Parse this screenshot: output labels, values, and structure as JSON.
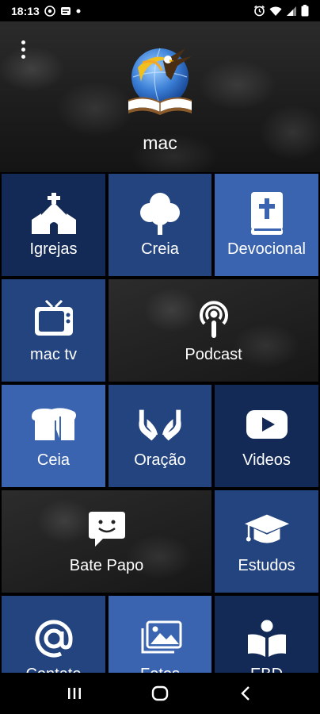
{
  "status_bar": {
    "time": "18:13",
    "left_icons": [
      "whatsapp-icon",
      "message-icon",
      "dot-icon"
    ],
    "right_icons": [
      "alarm-icon",
      "wifi-icon",
      "signal-icon",
      "battery-icon"
    ]
  },
  "header": {
    "app_name": "mac",
    "menu_icon": "more-vert-icon",
    "logo": "eagle-globe-bible-logo"
  },
  "tiles": [
    {
      "label": "Igrejas",
      "icon": "church-icon"
    },
    {
      "label": "Creia",
      "icon": "tree-icon"
    },
    {
      "label": "Devocional",
      "icon": "bible-icon"
    },
    {
      "label": "mac tv",
      "icon": "tv-icon"
    },
    {
      "label": "Podcast",
      "icon": "podcast-icon"
    },
    {
      "label": "Ceia",
      "icon": "bread-icon"
    },
    {
      "label": "Oração",
      "icon": "praying-hands-icon"
    },
    {
      "label": "Videos",
      "icon": "youtube-icon"
    },
    {
      "label": "Bate Papo",
      "icon": "chat-icon"
    },
    {
      "label": "Estudos",
      "icon": "graduation-cap-icon"
    },
    {
      "label": "Contato",
      "icon": "at-icon"
    },
    {
      "label": "Fotos",
      "icon": "photos-icon"
    },
    {
      "label": "EBD",
      "icon": "reader-icon"
    }
  ],
  "colors": {
    "dark_blue": "#132a57",
    "mid_blue": "#23447e",
    "light_blue": "#3a64b0"
  },
  "nav_bar": {
    "buttons": [
      "recents-icon",
      "home-icon",
      "back-icon"
    ]
  }
}
